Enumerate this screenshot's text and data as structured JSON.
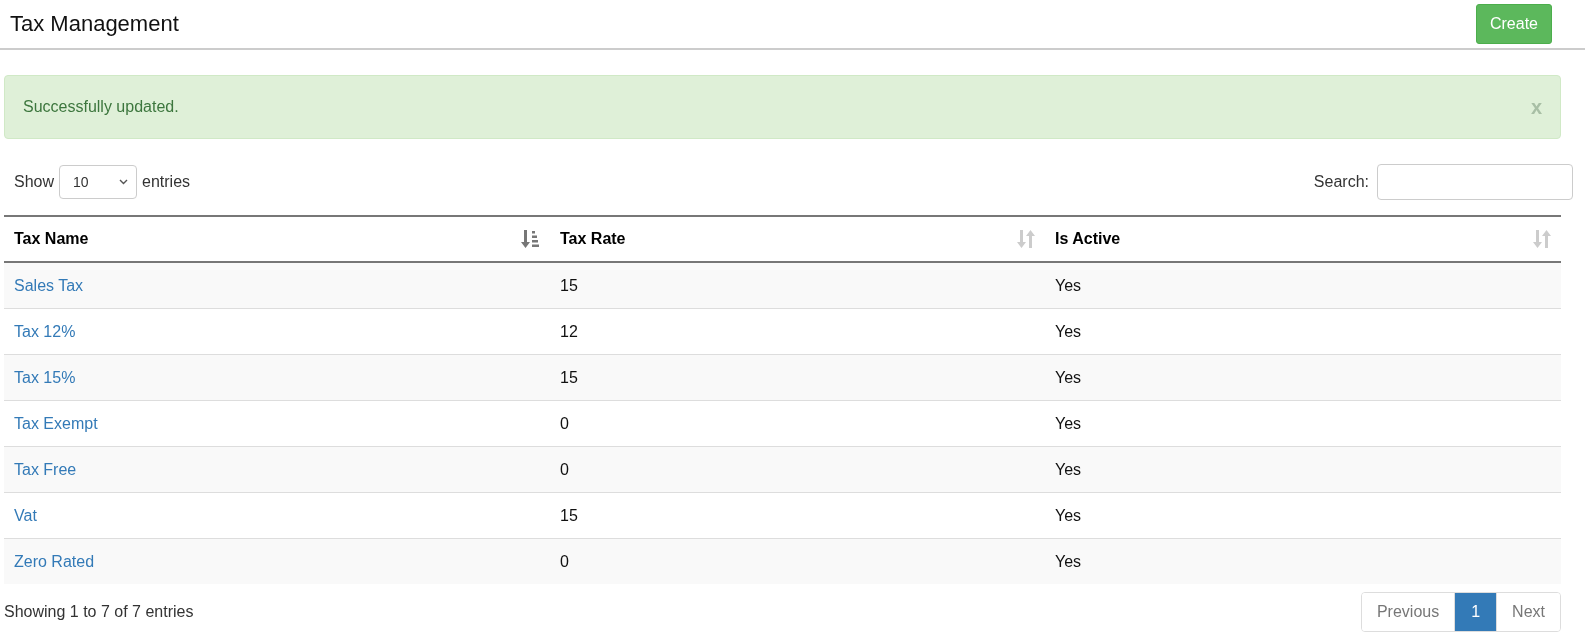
{
  "header": {
    "title": "Tax Management",
    "create_button": "Create"
  },
  "alert": {
    "message": "Successfully updated.",
    "close": "x"
  },
  "length_control": {
    "label_before": "Show",
    "value": "10",
    "label_after": "entries"
  },
  "search": {
    "label": "Search:"
  },
  "table": {
    "columns": [
      {
        "label": "Tax Name",
        "sorted": true
      },
      {
        "label": "Tax Rate",
        "sorted": false
      },
      {
        "label": "Is Active",
        "sorted": false
      }
    ],
    "rows": [
      {
        "tax_name": "Sales Tax",
        "tax_rate": "15",
        "is_active": "Yes"
      },
      {
        "tax_name": "Tax 12%",
        "tax_rate": "12",
        "is_active": "Yes"
      },
      {
        "tax_name": "Tax 15%",
        "tax_rate": "15",
        "is_active": "Yes"
      },
      {
        "tax_name": "Tax Exempt",
        "tax_rate": "0",
        "is_active": "Yes"
      },
      {
        "tax_name": "Tax Free",
        "tax_rate": "0",
        "is_active": "Yes"
      },
      {
        "tax_name": "Vat",
        "tax_rate": "15",
        "is_active": "Yes"
      },
      {
        "tax_name": "Zero Rated",
        "tax_rate": "0",
        "is_active": "Yes"
      }
    ]
  },
  "info": "Showing 1 to 7 of 7 entries",
  "pagination": [
    {
      "label": "Previous",
      "selected": false
    },
    {
      "label": "1",
      "selected": true
    },
    {
      "label": "Next",
      "selected": false
    }
  ]
}
